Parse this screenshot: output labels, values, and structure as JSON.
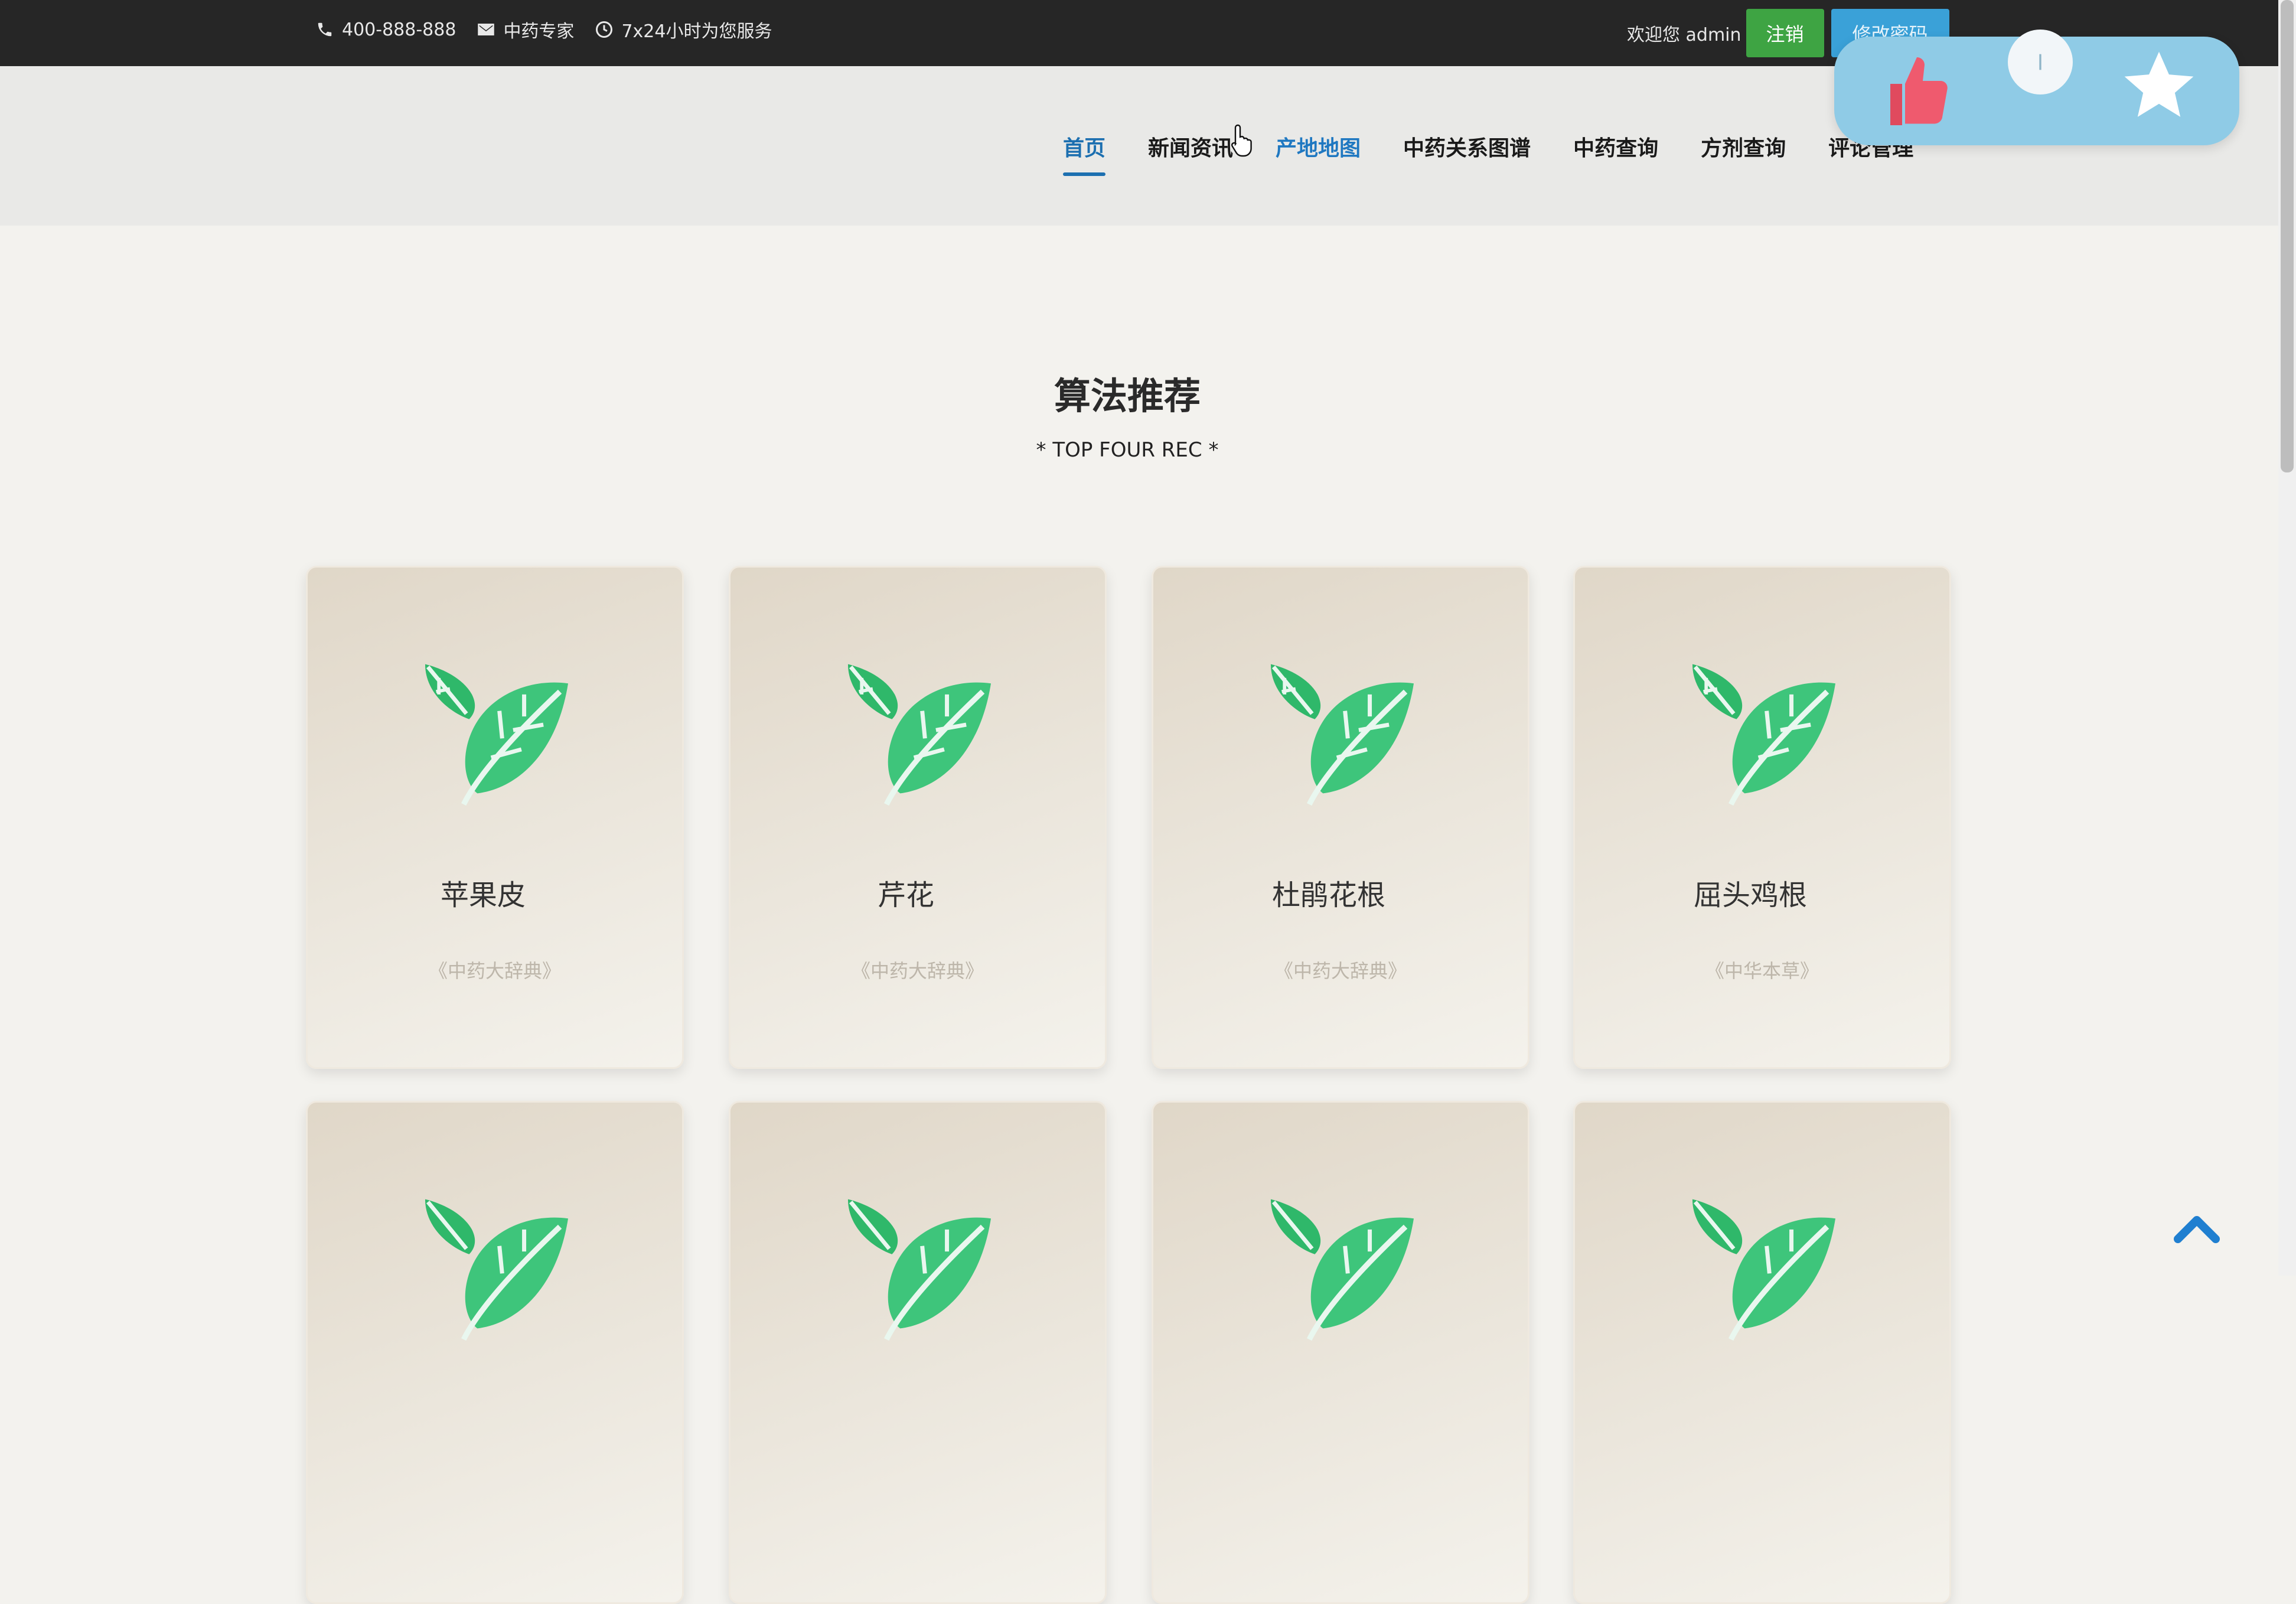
{
  "topbar": {
    "phone": "400-888-888",
    "expert": "中药专家",
    "service": "7x24小时为您服务",
    "welcome": "欢迎您 admin",
    "logout_label": "注销",
    "change_password_label": "修改密码"
  },
  "nav": {
    "items": [
      {
        "label": "首页"
      },
      {
        "label": "新闻资讯"
      },
      {
        "label": "产地地图"
      },
      {
        "label": "中药关系图谱"
      },
      {
        "label": "中药查询"
      },
      {
        "label": "方剂查询"
      },
      {
        "label": "评论管理"
      }
    ]
  },
  "section": {
    "title": "算法推荐",
    "subtitle": "* TOP FOUR REC *"
  },
  "cards": [
    {
      "name": "苹果皮",
      "source": "《中药大辞典》"
    },
    {
      "name": "芹花",
      "source": "《中药大辞典》"
    },
    {
      "name": "杜鹃花根",
      "source": "《中药大辞典》"
    },
    {
      "name": "屈头鸡根",
      "source": "《中华本草》"
    },
    {
      "name": "",
      "source": ""
    },
    {
      "name": "",
      "source": ""
    },
    {
      "name": "",
      "source": ""
    },
    {
      "name": "",
      "source": ""
    }
  ],
  "colors": {
    "topbar_bg": "#262626",
    "logout_bg": "#3ea443",
    "change_password_bg": "#3aa1d8",
    "nav_active": "#1c6fb0",
    "leaf_green": "#2fb86a",
    "badge_bg": "#8fcbe6"
  },
  "icons": {
    "phone": "phone-icon",
    "mail": "mail-icon",
    "clock": "clock-icon",
    "thumbs_up": "thumbs-up-icon",
    "star": "star-icon",
    "leaf": "leaf-icon",
    "back_to_top": "chevron-up-icon"
  }
}
